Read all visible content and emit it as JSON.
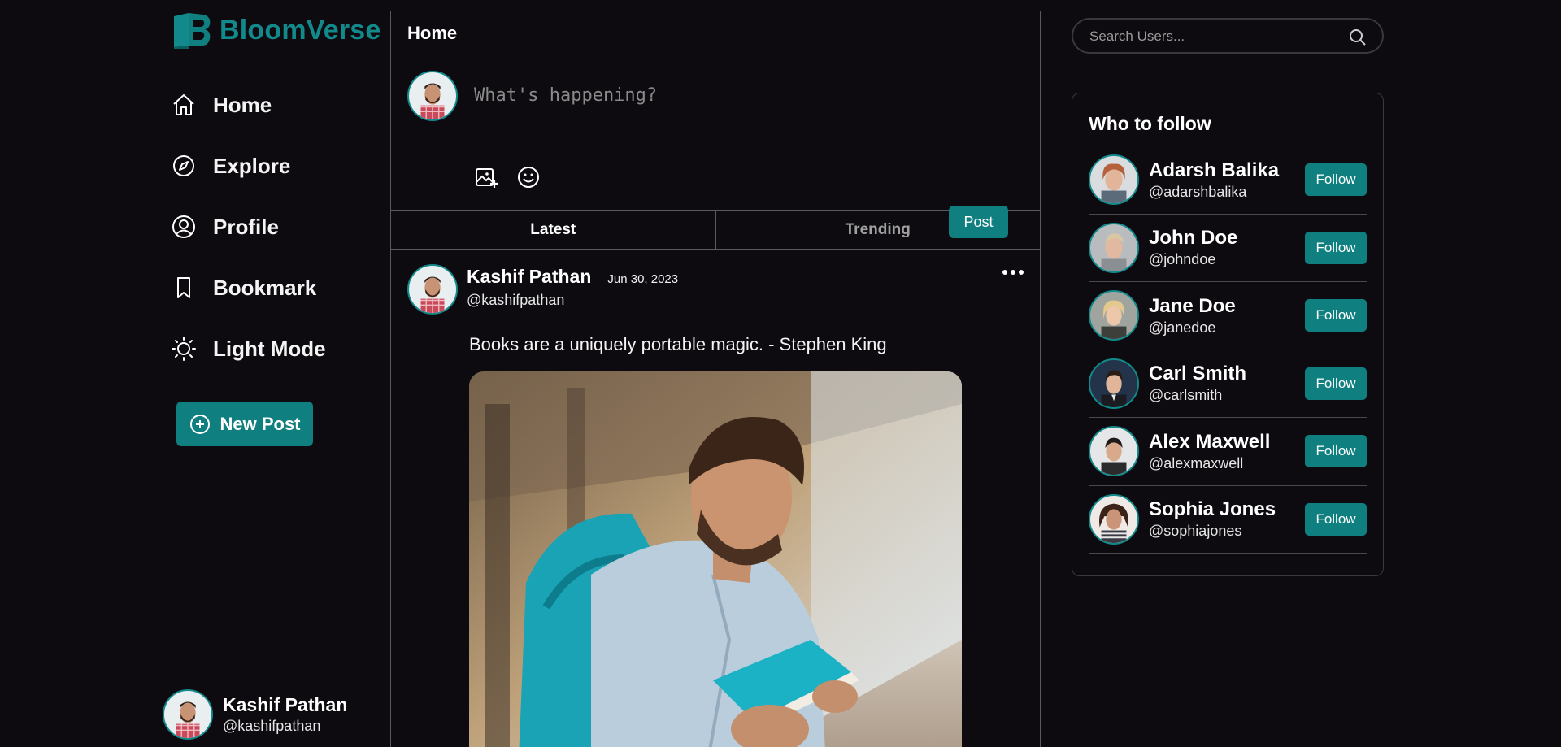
{
  "brand": {
    "name": "BloomVerse",
    "accent": "#0f7f80"
  },
  "nav": {
    "items": [
      {
        "label": "Home",
        "icon": "home-icon"
      },
      {
        "label": "Explore",
        "icon": "compass-icon"
      },
      {
        "label": "Profile",
        "icon": "user-circle-icon"
      },
      {
        "label": "Bookmark",
        "icon": "bookmark-icon"
      },
      {
        "label": "Light Mode",
        "icon": "sun-icon"
      }
    ],
    "new_post_label": "New Post"
  },
  "current_user": {
    "name": "Kashif Pathan",
    "handle": "@kashifpathan"
  },
  "main": {
    "title": "Home",
    "composer": {
      "placeholder": "What's happening?",
      "post_label": "Post"
    },
    "tabs": [
      {
        "label": "Latest",
        "active": true
      },
      {
        "label": "Trending",
        "active": false
      }
    ],
    "post": {
      "author": "Kashif Pathan",
      "date": "Jun 30, 2023",
      "handle": "@kashifpathan",
      "text": "Books are a uniquely portable magic. - Stephen King"
    }
  },
  "search": {
    "placeholder": "Search Users..."
  },
  "who_to_follow": {
    "title": "Who to follow",
    "follow_label": "Follow",
    "users": [
      {
        "name": "Adarsh Balika",
        "handle": "@adarshbalika"
      },
      {
        "name": "John Doe",
        "handle": "@johndoe"
      },
      {
        "name": "Jane Doe",
        "handle": "@janedoe"
      },
      {
        "name": "Carl Smith",
        "handle": "@carlsmith"
      },
      {
        "name": "Alex Maxwell",
        "handle": "@alexmaxwell"
      },
      {
        "name": "Sophia Jones",
        "handle": "@sophiajones"
      }
    ]
  }
}
